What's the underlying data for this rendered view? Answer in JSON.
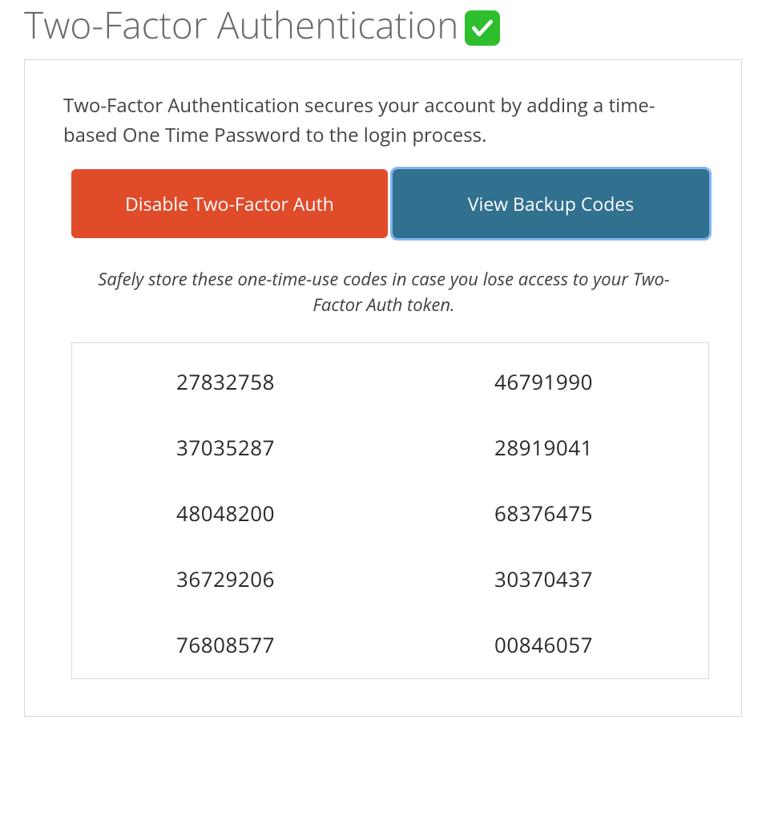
{
  "header": {
    "title": "Two-Factor Authentication"
  },
  "panel": {
    "description": "Two-Factor Authentication secures your account by adding a time-based One Time Password to the login process.",
    "buttons": {
      "disable_label": "Disable Two-Factor Auth",
      "view_label": "View Backup Codes"
    },
    "backup_instruction": "Safely store these one-time-use codes in case you lose access to your Two-Factor Auth token.",
    "backup_codes": {
      "column1": [
        "27832758",
        "37035287",
        "48048200",
        "36729206",
        "76808577"
      ],
      "column2": [
        "46791990",
        "28919041",
        "68376475",
        "30370437",
        "00846057"
      ]
    }
  }
}
